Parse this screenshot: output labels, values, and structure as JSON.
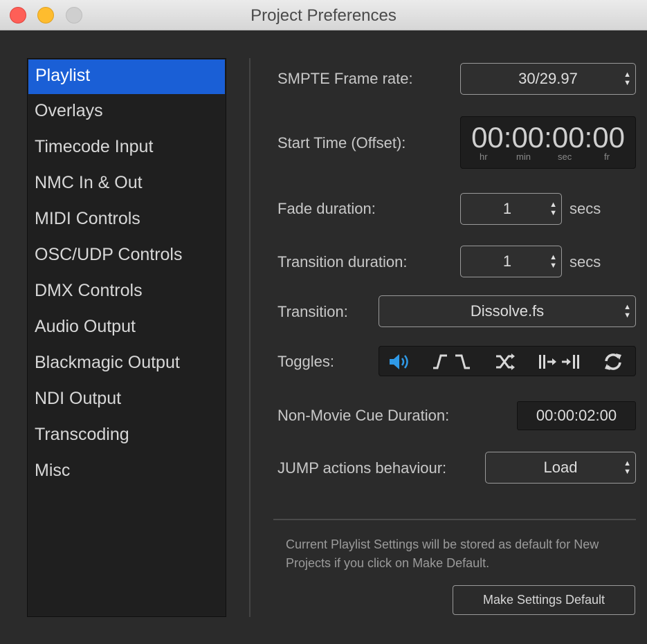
{
  "window": {
    "title": "Project Preferences"
  },
  "sidebar": {
    "items": [
      {
        "label": "Playlist",
        "selected": true
      },
      {
        "label": "Overlays"
      },
      {
        "label": "Timecode Input"
      },
      {
        "label": "NMC In & Out"
      },
      {
        "label": "MIDI Controls"
      },
      {
        "label": "OSC/UDP Controls"
      },
      {
        "label": "DMX Controls"
      },
      {
        "label": "Audio Output"
      },
      {
        "label": "Blackmagic Output"
      },
      {
        "label": "NDI Output"
      },
      {
        "label": "Transcoding"
      },
      {
        "label": "Misc"
      }
    ]
  },
  "settings": {
    "smpte": {
      "label": "SMPTE Frame rate:",
      "value": "30/29.97"
    },
    "start_time": {
      "label": "Start Time (Offset):",
      "value": "00:00:00:00",
      "units": {
        "hr": "hr",
        "min": "min",
        "sec": "sec",
        "fr": "fr"
      }
    },
    "fade": {
      "label": "Fade duration:",
      "value": "1",
      "unit": "secs"
    },
    "transition_duration": {
      "label": "Transition duration:",
      "value": "1",
      "unit": "secs"
    },
    "transition": {
      "label": "Transition:",
      "value": "Dissolve.fs"
    },
    "toggles": {
      "label": "Toggles:",
      "items": [
        {
          "icon": "speaker-icon",
          "active": true
        },
        {
          "icon": "fade-in-out-icon",
          "active": false
        },
        {
          "icon": "shuffle-icon",
          "active": false
        },
        {
          "icon": "play-next-icon",
          "active": false
        },
        {
          "icon": "loop-icon",
          "active": false
        }
      ]
    },
    "non_movie": {
      "label": "Non-Movie Cue Duration:",
      "value": "00:00:02:00"
    },
    "jump": {
      "label": "JUMP actions behaviour:",
      "value": "Load"
    }
  },
  "footer": {
    "note": "Current Playlist Settings will be stored as default for New Projects if you click on Make Default.",
    "button_label": "Make Settings Default"
  },
  "colors": {
    "accent": "#1a5fd6",
    "toggle_active": "#2f9ae8"
  }
}
